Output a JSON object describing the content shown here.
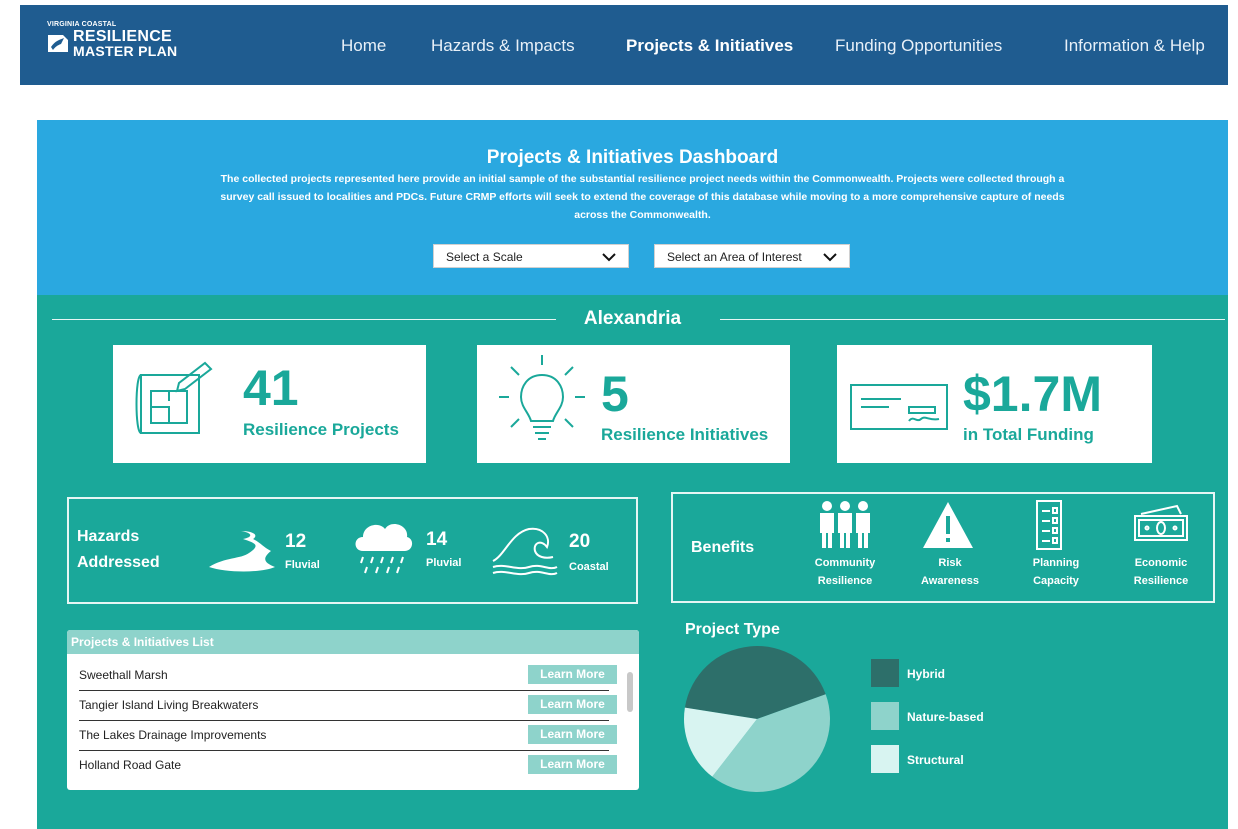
{
  "header": {
    "logo": {
      "top": "VIRGINIA COASTAL",
      "line1": "RESILIENCE",
      "line2": "MASTER PLAN"
    },
    "nav": [
      "Home",
      "Hazards & Impacts",
      "Projects & Initiatives",
      "Funding Opportunities",
      "Information & Help"
    ],
    "active_nav": "Projects & Initiatives"
  },
  "dashboard": {
    "title": "Projects & Initiatives Dashboard",
    "description": "The collected projects represented here provide an initial sample of the substantial resilience project needs within the Commonwealth. Projects were collected through a survey call issued to localities and PDCs. Future CRMP efforts will seek to extend the coverage of this database while moving to a more comprehensive capture of needs across the Commonwealth.",
    "scale_select": "Select a Scale",
    "area_select": "Select an Area of Interest"
  },
  "area": "Alexandria",
  "stats": [
    {
      "value": "41",
      "label": "Resilience Projects",
      "icon": "blueprint-icon"
    },
    {
      "value": "5",
      "label": "Resilience Initiatives",
      "icon": "lightbulb-icon"
    },
    {
      "value": "$1.7M",
      "label": "in Total Funding",
      "icon": "check-icon"
    }
  ],
  "hazards": {
    "heading_1": "Hazards",
    "heading_2": "Addressed",
    "items": [
      {
        "count": "12",
        "label": "Fluvial",
        "icon": "river-icon"
      },
      {
        "count": "14",
        "label": "Pluvial",
        "icon": "rain-cloud-icon"
      },
      {
        "count": "20",
        "label": "Coastal",
        "icon": "wave-icon"
      }
    ]
  },
  "benefits": {
    "heading": "Benefits",
    "items": [
      {
        "line1": "Community",
        "line2": "Resilience",
        "icon": "people-icon"
      },
      {
        "line1": "Risk",
        "line2": "Awareness",
        "icon": "warning-icon"
      },
      {
        "line1": "Planning",
        "line2": "Capacity",
        "icon": "checklist-icon"
      },
      {
        "line1": "Economic",
        "line2": "Resilience",
        "icon": "money-icon"
      }
    ]
  },
  "project_list": {
    "heading": "Projects & Initiatives List",
    "button_label": "Learn More",
    "items": [
      "Sweethall Marsh",
      "Tangier Island Living Breakwaters",
      "The Lakes Drainage Improvements",
      "Holland Road Gate"
    ]
  },
  "chart_data": {
    "type": "pie",
    "title": "Project Type",
    "categories": [
      "Hybrid",
      "Nature-based",
      "Structural"
    ],
    "values": [
      42,
      41,
      17
    ],
    "colors": [
      "#2d6f6a",
      "#8ed3cb",
      "#d8f4f1"
    ],
    "legend_placement": "right"
  },
  "colors": {
    "header": "#1f5c90",
    "band": "#2aa8e0",
    "teal": "#1aa89a"
  }
}
